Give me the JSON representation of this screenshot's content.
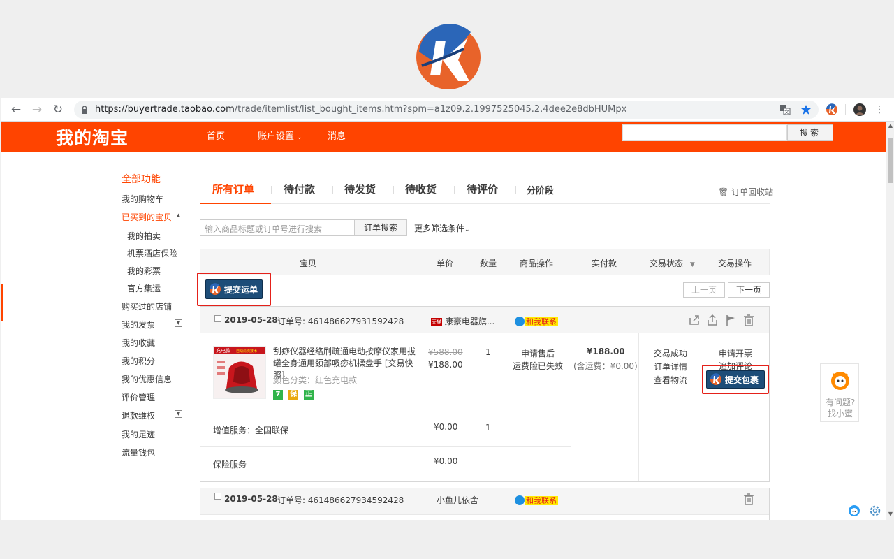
{
  "browser": {
    "url_host": "https://buyertrade.taobao.com",
    "url_path": "/trade/itemlist/list_bought_items.htm?spm=a1z09.2.1997525045.2.4dee2e8dbHUMpx"
  },
  "topnav": {
    "brand": "我的淘宝",
    "items": [
      "首页",
      "账户设置",
      "消息"
    ],
    "search_button": "搜索"
  },
  "sidebar": {
    "head": "全部功能",
    "items": [
      "我的购物车",
      "已买到的宝贝",
      "我的拍卖",
      "机票酒店保险",
      "我的彩票",
      "官方集运",
      "购买过的店铺",
      "我的发票",
      "我的收藏",
      "我的积分",
      "我的优惠信息",
      "评价管理",
      "退款维权",
      "我的足迹",
      "流量钱包"
    ]
  },
  "tabs": [
    "所有订单",
    "待付款",
    "待发货",
    "待收货",
    "待评价",
    "分阶段"
  ],
  "recycle_bin": "订单回收站",
  "filter": {
    "placeholder": "输入商品标题或订单号进行搜索",
    "search_button": "订单搜索",
    "more": "更多筛选条件"
  },
  "table_headers": [
    "宝贝",
    "单价",
    "数量",
    "商品操作",
    "实付款",
    "交易状态",
    "交易操作"
  ],
  "submit_waybill": "提交运单",
  "pager": {
    "prev": "上一页",
    "next": "下一页"
  },
  "orders": [
    {
      "date": "2019-05-28",
      "order_no_label": "订单号:",
      "order_no": "461486627931592428",
      "shop": "康豪电器旗...",
      "shop_badge": "天猫",
      "contact": "和我联系",
      "product_title": "刮痧仪器经络刷疏通电动按摩仪家用拔罐全身通用颈部吸痧机揉盘手 [交易快照]",
      "product_sku": "颜色分类：红色充电款",
      "badges": [
        "7",
        "保",
        "正"
      ],
      "original_price": "¥588.00",
      "price": "¥188.00",
      "quantity": "1",
      "item_actions": [
        "申请售后",
        "运费险已失效"
      ],
      "paid": "¥188.00",
      "paid_note": "(含运费：¥0.00)",
      "status": [
        "交易成功",
        "订单详情",
        "查看物流"
      ],
      "actions": [
        "申请开票",
        "追加评论"
      ],
      "pack_button": "提交包裹",
      "extras": [
        {
          "label": "增值服务：全国联保",
          "price": "¥0.00",
          "qty": "1"
        },
        {
          "label": "保险服务",
          "price": "¥0.00",
          "qty": ""
        }
      ],
      "product_image_text": "充电款",
      "product_image_sub": "自动清洗技术"
    },
    {
      "date": "2019-05-28",
      "order_no_label": "订单号:",
      "order_no": "461486627934592428",
      "shop": "小鱼儿依舍",
      "contact": "和我联系"
    }
  ],
  "helper": {
    "line1": "有问题?",
    "line2": "找小蜜"
  }
}
